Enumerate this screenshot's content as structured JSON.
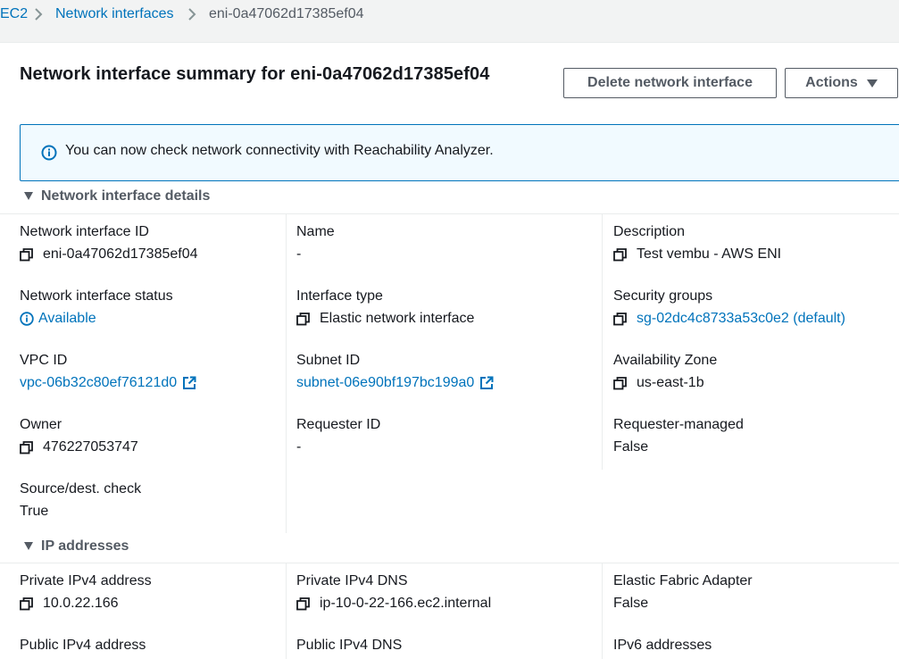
{
  "breadcrumb": {
    "items": [
      {
        "label": "EC2"
      },
      {
        "label": "Network interfaces"
      },
      {
        "label": "eni-0a47062d17385ef04"
      }
    ]
  },
  "header": {
    "title": "Network interface summary for eni-0a47062d17385ef04",
    "delete_label": "Delete network interface",
    "actions_label": "Actions"
  },
  "alert": {
    "text": "You can now check network connectivity with Reachability Analyzer."
  },
  "details": {
    "heading": "Network interface details",
    "eni_id": {
      "label": "Network interface ID",
      "value": "eni-0a47062d17385ef04"
    },
    "name": {
      "label": "Name",
      "value": "-"
    },
    "description": {
      "label": "Description",
      "value": "Test vembu - AWS ENI"
    },
    "status": {
      "label": "Network interface status",
      "value": "Available"
    },
    "interface_type": {
      "label": "Interface type",
      "value": "Elastic network interface"
    },
    "security_groups": {
      "label": "Security groups",
      "value": "sg-02dc4c8733a53c0e2 (default)"
    },
    "vpc_id": {
      "label": "VPC ID",
      "value": "vpc-06b32c80ef76121d0"
    },
    "subnet_id": {
      "label": "Subnet ID",
      "value": "subnet-06e90bf197bc199a0"
    },
    "availability_zone": {
      "label": "Availability Zone",
      "value": "us-east-1b"
    },
    "owner": {
      "label": "Owner",
      "value": "476227053747"
    },
    "requester_id": {
      "label": "Requester ID",
      "value": "-"
    },
    "requester_managed": {
      "label": "Requester-managed",
      "value": "False"
    },
    "source_dest_check": {
      "label": "Source/dest. check",
      "value": "True"
    }
  },
  "ip": {
    "heading": "IP addresses",
    "private_ipv4": {
      "label": "Private IPv4 address",
      "value": "10.0.22.166"
    },
    "private_dns": {
      "label": "Private IPv4 DNS",
      "value": "ip-10-0-22-166.ec2.internal"
    },
    "efa": {
      "label": "Elastic Fabric Adapter",
      "value": "False"
    },
    "public_ipv4": {
      "label": "Public IPv4 address"
    },
    "public_dns": {
      "label": "Public IPv4 DNS"
    },
    "ipv6": {
      "label": "IPv6 addresses"
    }
  },
  "colors": {
    "link": "#0073bb",
    "text": "#16191f",
    "muted": "#545b64",
    "background": "#f2f3f3",
    "alert_border": "#0073bb",
    "alert_bg": "#f1faff"
  },
  "icons": [
    "chevron-right-icon",
    "copy-icon",
    "external-link-icon",
    "info-icon",
    "status-info-icon",
    "caret-down-icon",
    "triangle-down-icon"
  ]
}
